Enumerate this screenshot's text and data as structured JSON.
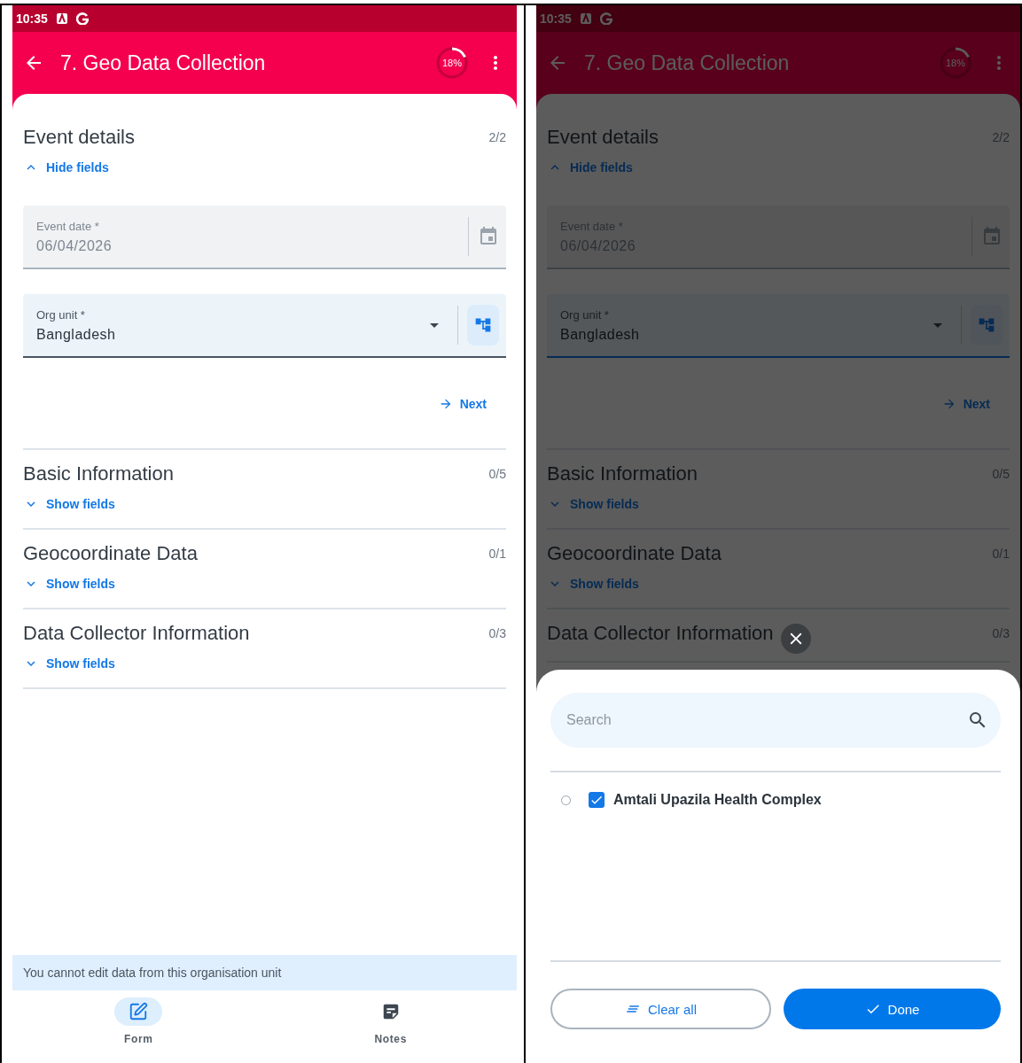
{
  "screens": [
    {
      "status_bar": {
        "time": "10:35"
      },
      "app_bar": {
        "title": "7. Geo Data Collection",
        "progress": {
          "label": "18%"
        }
      },
      "sections": [
        {
          "title": "Event details",
          "count": "2/2",
          "expanded": true,
          "toggle_label": "Hide fields",
          "fields": [
            {
              "kind": "date",
              "label": "Event date *",
              "value": "06/04/2026",
              "disabled": true,
              "focused": false
            },
            {
              "kind": "org_unit",
              "label": "Org unit *",
              "value": "Bangladesh",
              "disabled": false,
              "focused": false
            }
          ],
          "next_label": "Next"
        },
        {
          "title": "Basic Information",
          "count": "0/5",
          "expanded": false,
          "toggle_label": "Show fields"
        },
        {
          "title": "Geocoordinate Data",
          "count": "0/1",
          "expanded": false,
          "toggle_label": "Show fields"
        },
        {
          "title": "Data Collector Information",
          "count": "0/3",
          "expanded": false,
          "toggle_label": "Show fields"
        }
      ],
      "banner": "You cannot edit data from this organisation unit",
      "bottom_nav": [
        {
          "label": "Form",
          "kind": "form",
          "selected": true
        },
        {
          "label": "Notes",
          "kind": "notes",
          "selected": false
        }
      ]
    },
    {
      "dimmed": true,
      "status_bar": {
        "time": "10:35"
      },
      "app_bar": {
        "title": "7. Geo Data Collection",
        "progress": {
          "label": "18%"
        }
      },
      "sections": [
        {
          "title": "Event details",
          "count": "2/2",
          "expanded": true,
          "toggle_label": "Hide fields",
          "fields": [
            {
              "kind": "date",
              "label": "Event date *",
              "value": "06/04/2026",
              "disabled": true,
              "focused": false
            },
            {
              "kind": "org_unit",
              "label": "Org unit *",
              "value": "Bangladesh",
              "disabled": false,
              "focused": true
            }
          ],
          "next_label": "Next"
        },
        {
          "title": "Basic Information",
          "count": "0/5",
          "expanded": false,
          "toggle_label": "Show fields"
        },
        {
          "title": "Geocoordinate Data",
          "count": "0/1",
          "expanded": false,
          "toggle_label": "Show fields"
        },
        {
          "title": "Data Collector Information",
          "count": "0/3"
        }
      ],
      "sheet": {
        "search": {
          "placeholder": "Search"
        },
        "items": [
          {
            "label": "Amtali Upazila Health Complex",
            "selected": false,
            "checked": true
          }
        ],
        "buttons": [
          {
            "kind": "clear",
            "label": "Clear all"
          },
          {
            "kind": "done",
            "label": "Done"
          }
        ]
      }
    }
  ]
}
